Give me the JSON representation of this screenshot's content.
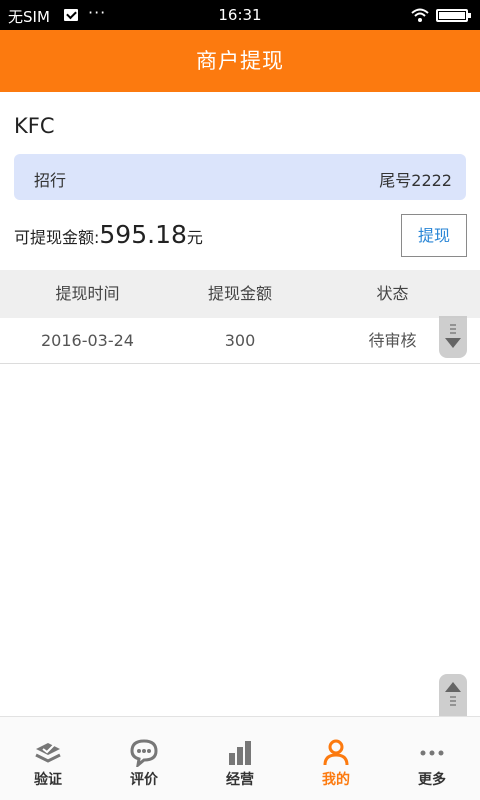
{
  "status_bar": {
    "carrier": "无SIM",
    "dots": "···",
    "time": "16:31"
  },
  "header": {
    "title": "商户提现"
  },
  "merchant": {
    "name": "KFC"
  },
  "bank": {
    "name": "招行",
    "tail": "尾号2222"
  },
  "balance": {
    "label": "可提现金额:",
    "amount": "595.18",
    "unit": "元"
  },
  "withdraw_button": "提现",
  "table": {
    "headers": [
      "提现时间",
      "提现金额",
      "状态"
    ],
    "rows": [
      [
        "2016-03-24",
        "300",
        "待审核"
      ]
    ]
  },
  "bottom_nav": {
    "items": [
      {
        "label": "验证",
        "icon": "verify-icon"
      },
      {
        "label": "评价",
        "icon": "comment-icon"
      },
      {
        "label": "经营",
        "icon": "bar-chart-icon"
      },
      {
        "label": "我的",
        "icon": "person-icon",
        "active": true
      },
      {
        "label": "更多",
        "icon": "more-icon"
      }
    ]
  },
  "colors": {
    "accent": "#fc7a0f",
    "card_bg": "#dbe4fb",
    "link": "#2a86d6"
  }
}
